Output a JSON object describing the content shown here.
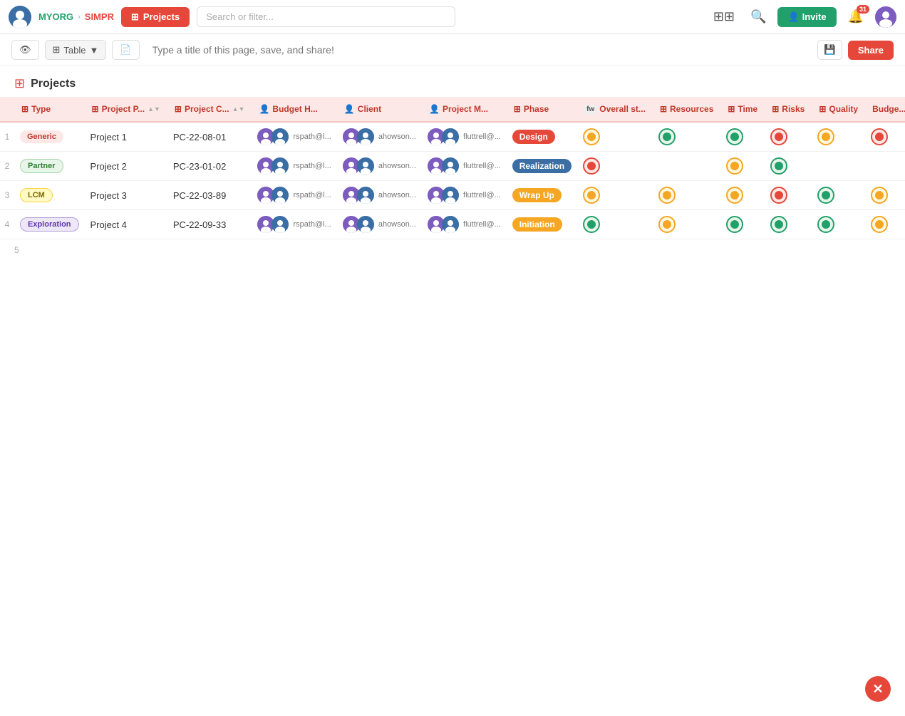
{
  "topbar": {
    "org_name": "MYORG",
    "separator": "›",
    "project_name": "SIMPR",
    "projects_btn": "Projects",
    "search_placeholder": "Search or filter...",
    "invite_label": "Invite",
    "notif_count": "31"
  },
  "toolbar": {
    "table_label": "Table",
    "page_title_placeholder": "Type a title of this page, save, and share!",
    "share_label": "Share"
  },
  "page": {
    "title": "Projects"
  },
  "table": {
    "columns": [
      {
        "label": "Type",
        "icon": "⊞"
      },
      {
        "label": "Project P...",
        "icon": "⊞",
        "sort": true
      },
      {
        "label": "Project C...",
        "icon": "⊞",
        "sort": true
      },
      {
        "label": "Budget H...",
        "icon": "👤"
      },
      {
        "label": "Client",
        "icon": "👤"
      },
      {
        "label": "Project M...",
        "icon": "👤"
      },
      {
        "label": "Phase",
        "icon": "⊞"
      },
      {
        "label": "Overall st...",
        "icon": "fw"
      },
      {
        "label": "Resources",
        "icon": "⊞"
      },
      {
        "label": "Time",
        "icon": "⊞"
      },
      {
        "label": "Risks",
        "icon": "⊞"
      },
      {
        "label": "Quality",
        "icon": "⊞"
      },
      {
        "label": "Budge..."
      }
    ],
    "rows": [
      {
        "num": "1",
        "type": "Generic",
        "type_class": "badge-generic",
        "project_name": "Project 1",
        "project_code": "PC-22-08-01",
        "phase": "Design",
        "phase_class": "phase-design",
        "overall": "yellow",
        "resources": "green",
        "time": "green",
        "risks": "red",
        "quality": "yellow",
        "budget": "red"
      },
      {
        "num": "2",
        "type": "Partner",
        "type_class": "badge-partner",
        "project_name": "Project 2",
        "project_code": "PC-23-01-02",
        "phase": "Realization",
        "phase_class": "phase-realization",
        "overall": "red",
        "resources": "",
        "time": "yellow",
        "risks": "green",
        "quality": "",
        "budget": ""
      },
      {
        "num": "3",
        "type": "LCM",
        "type_class": "badge-lcm",
        "project_name": "Project 3",
        "project_code": "PC-22-03-89",
        "phase": "Wrap Up",
        "phase_class": "phase-wrapup",
        "overall": "yellow",
        "resources": "yellow",
        "time": "yellow",
        "risks": "red",
        "quality": "green",
        "budget": "yellow"
      },
      {
        "num": "4",
        "type": "Exploration",
        "type_class": "badge-exploration",
        "project_name": "Project 4",
        "project_code": "PC-22-09-33",
        "phase": "Initiation",
        "phase_class": "phase-initiation",
        "overall": "green",
        "resources": "yellow",
        "time": "green",
        "risks": "green",
        "quality": "green",
        "budget": "yellow"
      }
    ]
  },
  "error_badge": "✕"
}
